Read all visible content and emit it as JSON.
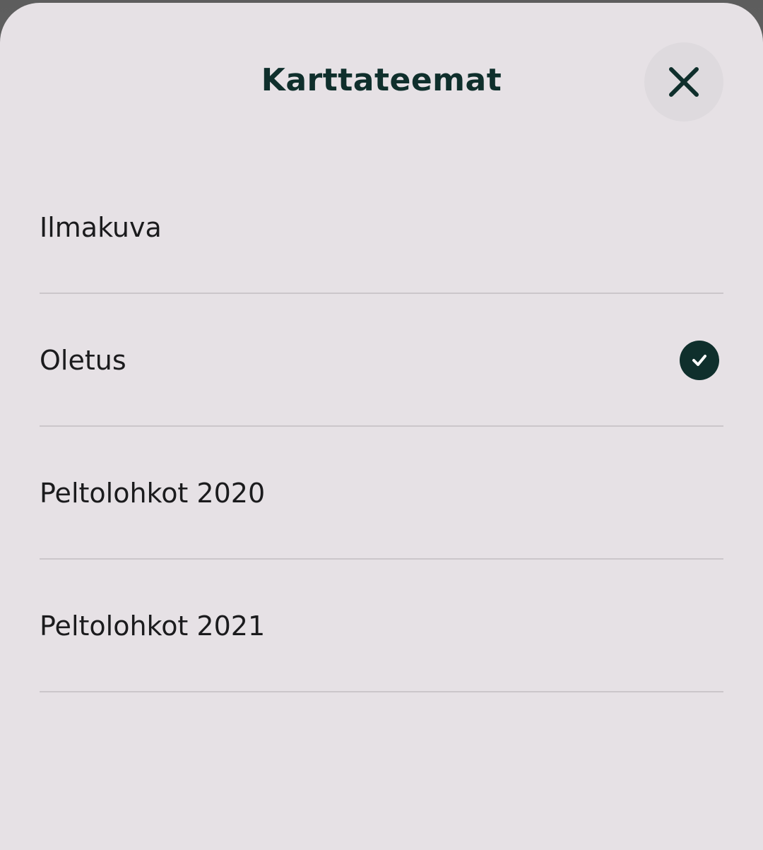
{
  "sheet": {
    "title": "Karttateemat",
    "close_icon": "close-icon",
    "selected_index": 1,
    "items": [
      {
        "label": "Ilmakuva",
        "selected": false
      },
      {
        "label": "Oletus",
        "selected": true
      },
      {
        "label": "Peltolohkot 2020",
        "selected": false
      },
      {
        "label": "Peltolohkot 2021",
        "selected": false
      }
    ]
  },
  "colors": {
    "sheet_background": "#e6e1e5",
    "accent": "#0f2f2c",
    "divider": "#cbc6ca",
    "text": "#1b1b1d"
  }
}
